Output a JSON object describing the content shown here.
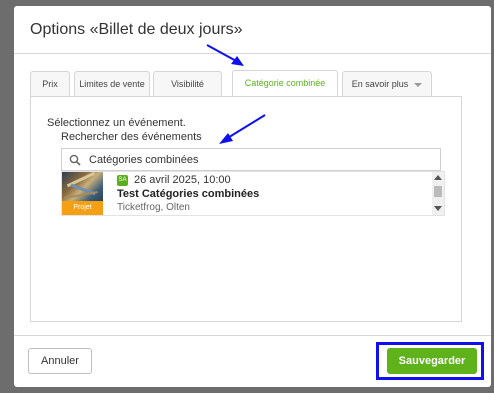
{
  "dialog": {
    "title": "Options «Billet de deux jours»"
  },
  "tabs": [
    {
      "label": "Prix",
      "active": false
    },
    {
      "label": "Limites de vente",
      "active": false
    },
    {
      "label": "Visibilité",
      "active": false
    },
    {
      "label": "Catégorie combinée",
      "active": true
    },
    {
      "label": "En savoir plus",
      "active": false,
      "dropdown": true
    }
  ],
  "panel": {
    "select_label": "Sélectionnez un événement.",
    "search_label": "Rechercher des événements",
    "search_value": "Catégories combinées",
    "search_icon": "search-icon"
  },
  "result": {
    "badge": "SA",
    "date": "26 avril 2025, 10:00",
    "name": "Test Catégories combinées",
    "venue": "Ticketfrog, Olten",
    "project_tag": "Projet"
  },
  "footer": {
    "cancel_label": "Annuler",
    "save_label": "Sauvegarder"
  },
  "colors": {
    "accent_green": "#5fb21c",
    "active_tab_text": "#5cae1f",
    "project_tag_bg": "#f4a012",
    "annotation_blue": "#1010ee",
    "overlay": "#6d6d6d"
  }
}
